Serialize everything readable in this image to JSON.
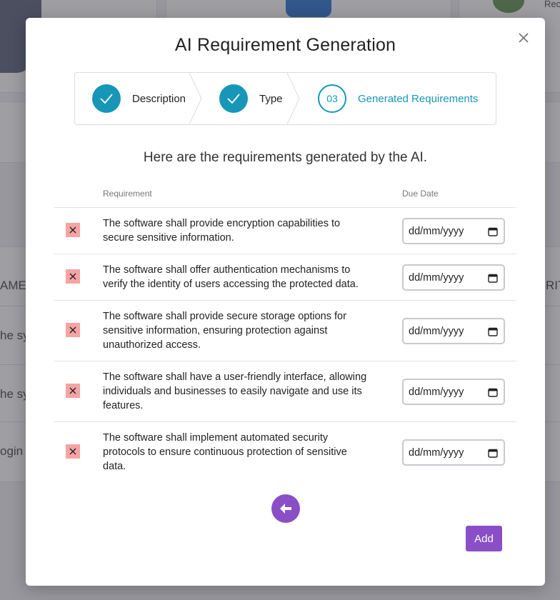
{
  "background": {
    "left_col_header": "AME",
    "right_col_header": "RIT",
    "row_1": "he sy",
    "row_2": "he sy",
    "row_3": "ogin p",
    "top_right_label": "Rec"
  },
  "modal": {
    "title": "AI Requirement Generation",
    "close_icon": "close-icon",
    "stepper": {
      "steps": [
        {
          "label": "Description",
          "state": "done"
        },
        {
          "label": "Type",
          "state": "done"
        },
        {
          "label": "Generated Requirements",
          "state": "current",
          "number": "03"
        }
      ]
    },
    "subtitle": "Here are the requirements generated by the AI.",
    "table": {
      "headers": {
        "requirement": "Requirement",
        "due_date": "Due Date"
      },
      "rows": [
        {
          "text": "The software shall provide encryption capabilities to secure sensitive information.",
          "date_placeholder": "dd/mm/yyyy"
        },
        {
          "text": "The software shall offer authentication mechanisms to verify the identity of users accessing the protected data.",
          "date_placeholder": "dd/mm/yyyy"
        },
        {
          "text": "The software shall provide secure storage options for sensitive information, ensuring protection against unauthorized access.",
          "date_placeholder": "dd/mm/yyyy"
        },
        {
          "text": "The software shall have a user-friendly interface, allowing individuals and businesses to easily navigate and use its features.",
          "date_placeholder": "dd/mm/yyyy"
        },
        {
          "text": "The software shall implement automated security protocols to ensure continuous protection of sensitive data.",
          "date_placeholder": "dd/mm/yyyy"
        }
      ]
    },
    "back_icon": "arrow-left-icon",
    "add_label": "Add"
  },
  "colors": {
    "accent_teal": "#1697b7",
    "accent_purple": "#8a4fc6",
    "delete_bg": "#f5a3a3"
  }
}
